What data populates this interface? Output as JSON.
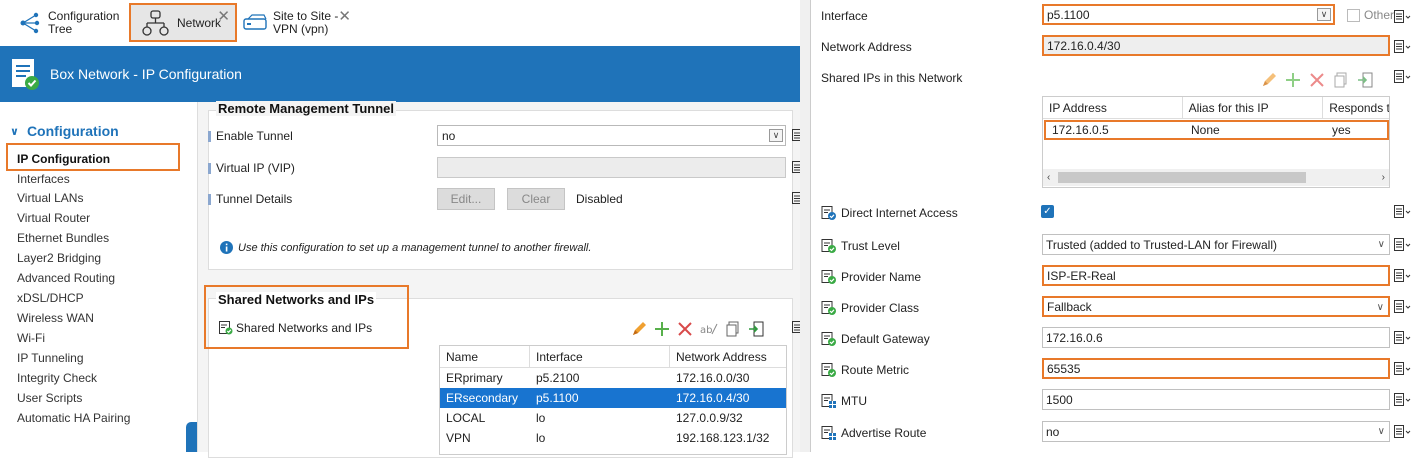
{
  "tabs": [
    {
      "label_l1": "Configuration",
      "label_l2": "Tree"
    },
    {
      "label": "Network",
      "close": "✕"
    },
    {
      "label_l1": "Site to Site -",
      "label_l2": "VPN (vpn)",
      "close": "✕"
    }
  ],
  "header": {
    "title": "Box Network - IP Configuration"
  },
  "sidebar": {
    "heading": "Configuration",
    "items": [
      "IP Configuration",
      "Interfaces",
      "Virtual LANs",
      "Virtual Router",
      "Ethernet Bundles",
      "Layer2 Bridging",
      "Advanced Routing",
      "xDSL/DHCP",
      "Wireless WAN",
      "Wi-Fi",
      "IP Tunneling",
      "Integrity Check",
      "User Scripts",
      "Automatic HA Pairing"
    ]
  },
  "tunnel": {
    "title": "Remote Management Tunnel",
    "enable_label": "Enable Tunnel",
    "enable_value": "no",
    "vip_label": "Virtual IP (VIP)",
    "vip_value": "",
    "details_label": "Tunnel Details",
    "edit_btn": "Edit...",
    "clear_btn": "Clear",
    "status": "Disabled",
    "info": "Use this configuration to set up a management tunnel to another firewall."
  },
  "shared": {
    "title": "Shared Networks and IPs",
    "sub_label": "Shared Networks and IPs",
    "columns": [
      "Name",
      "Interface",
      "Network Address"
    ],
    "rows": [
      [
        "ERprimary",
        "p5.2100",
        "172.16.0.0/30"
      ],
      [
        "ERsecondary",
        "p5.1100",
        "172.16.0.4/30"
      ],
      [
        "LOCAL",
        "lo",
        "127.0.0.9/32"
      ],
      [
        "VPN",
        "lo",
        "192.168.123.1/32"
      ]
    ],
    "selected_row": 1
  },
  "right": {
    "interface_label": "Interface",
    "interface_value": "p5.1100",
    "other_label": "Other",
    "netaddr_label": "Network Address",
    "netaddr_value": "172.16.0.4/30",
    "shared_ips_label": "Shared IPs in this Network",
    "ip_columns": [
      "IP Address",
      "Alias for this IP",
      "Responds t"
    ],
    "ip_rows": [
      [
        "172.16.0.5",
        "None",
        "yes"
      ]
    ],
    "direct_label": "Direct Internet Access",
    "direct_checked": true,
    "trust_label": "Trust Level",
    "trust_value": "Trusted (added to Trusted-LAN for Firewall)",
    "provider_name_label": "Provider Name",
    "provider_name_value": "ISP-ER-Real",
    "provider_class_label": "Provider Class",
    "provider_class_value": "Fallback",
    "gateway_label": "Default Gateway",
    "gateway_value": "172.16.0.6",
    "metric_label": "Route Metric",
    "metric_value": "65535",
    "mtu_label": "MTU",
    "mtu_value": "1500",
    "advertise_label": "Advertise Route",
    "advertise_value": "no"
  },
  "colors": {
    "accent": "#1f73b9",
    "highlight": "#e8792a",
    "selected_row": "#1874d0"
  }
}
